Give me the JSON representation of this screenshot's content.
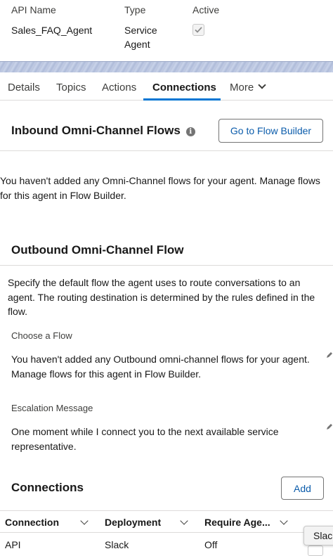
{
  "header": {
    "labels": {
      "api_name": "API Name",
      "type": "Type",
      "active": "Active"
    },
    "values": {
      "api_name": "Sales_FAQ_Agent",
      "type_line1": "Service",
      "type_line2": "Agent",
      "active_checked": true
    }
  },
  "tabs": [
    {
      "label": "Details",
      "active": false
    },
    {
      "label": "Topics",
      "active": false
    },
    {
      "label": "Actions",
      "active": false
    },
    {
      "label": "Connections",
      "active": true
    },
    {
      "label": "More",
      "active": false
    }
  ],
  "inbound": {
    "title": "Inbound Omni-Channel Flows",
    "button": "Go to Flow Builder",
    "empty_line1": "You haven't added any Omni-Channel flows for your agent. Manage flows",
    "empty_line2": "for this agent in Flow Builder."
  },
  "outbound": {
    "title": "Outbound Omni-Channel Flow",
    "desc_line1": "Specify the default flow the agent uses to route conversations to an",
    "desc_line2": "agent. The routing destination is determined by the rules defined in the",
    "desc_line3": "flow.",
    "choose_label": "Choose a Flow",
    "choose_line1": "You haven't added any Outbound omni-channel flows for your agent.",
    "choose_line2": "Manage flows for this agent in Flow Builder.",
    "escalation_label": "Escalation Message",
    "escalation_line1": "One moment while I connect you to the next available service",
    "escalation_line2": "representative."
  },
  "connections": {
    "title": "Connections",
    "add_button": "Add",
    "columns": [
      "Connection",
      "Deployment",
      "Require Age..."
    ],
    "rows": [
      {
        "connection": "API",
        "deployment": "Slack",
        "require": "Off"
      }
    ],
    "tooltip": "Slac"
  },
  "colors": {
    "accent": "#0176d3",
    "link": "#0b5cab",
    "border": "#dddbda"
  }
}
